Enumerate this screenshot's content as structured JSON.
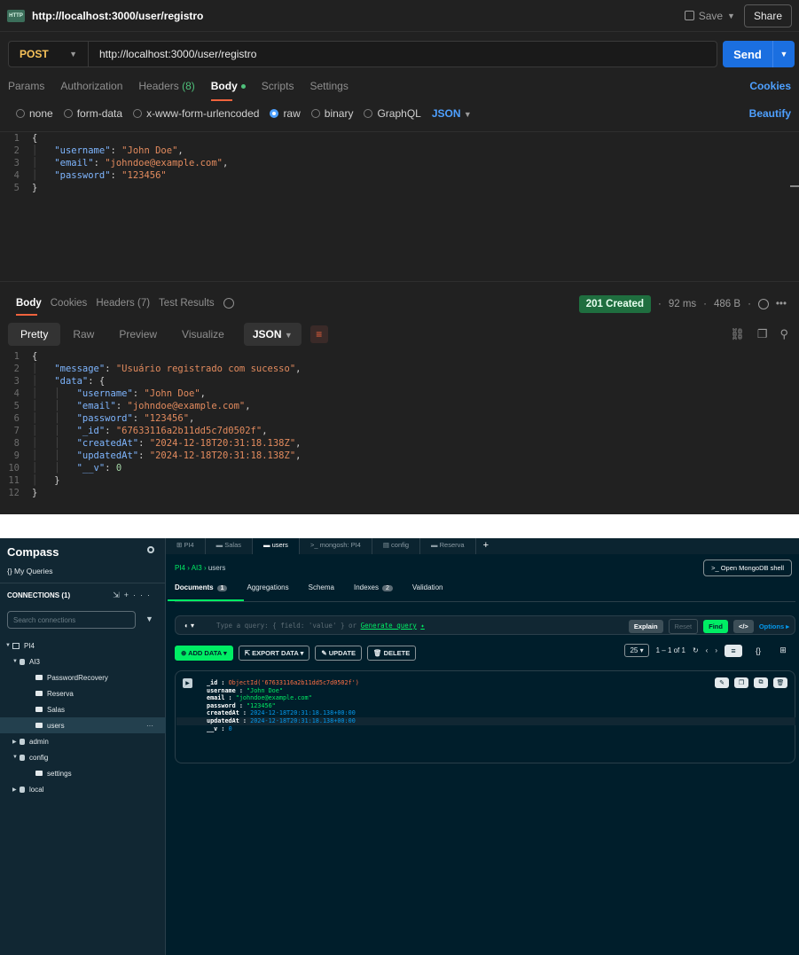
{
  "postman": {
    "window_title": "http://localhost:3000/user/registro",
    "http_icon_text": "HTTP",
    "save_label": "Save",
    "share_label": "Share",
    "method": "POST",
    "url": "http://localhost:3000/user/registro",
    "send_label": "Send",
    "request_tabs": [
      "Params",
      "Authorization",
      "Headers",
      "(8)",
      "Body",
      "Scripts",
      "Settings"
    ],
    "cookies_label": "Cookies",
    "body_types": [
      "none",
      "form-data",
      "x-www-form-urlencoded",
      "raw",
      "binary",
      "GraphQL"
    ],
    "body_format": "JSON",
    "beautify_label": "Beautify",
    "request_body": [
      {
        "n": "1",
        "t": "{"
      },
      {
        "n": "2",
        "k": "\"username\"",
        "v": "\"John Doe\"",
        "c": ","
      },
      {
        "n": "3",
        "k": "\"email\"",
        "v": "\"johndoe@example.com\"",
        "c": ","
      },
      {
        "n": "4",
        "k": "\"password\"",
        "v": "\"123456\"",
        "c": ""
      },
      {
        "n": "5",
        "t": "}"
      }
    ],
    "response_tabs": [
      "Body",
      "Cookies",
      "Headers",
      "(7)",
      "Test Results"
    ],
    "status": "201 Created",
    "time": "92 ms",
    "size": "486 B",
    "more_label": "•••",
    "format_tabs": [
      "Pretty",
      "Raw",
      "Preview",
      "Visualize"
    ],
    "response_format": "JSON",
    "response_body": [
      {
        "n": "1",
        "indent": 0,
        "t": "{"
      },
      {
        "n": "2",
        "indent": 1,
        "k": "\"message\"",
        "v": "\"Usuário registrado com sucesso\"",
        "c": ","
      },
      {
        "n": "3",
        "indent": 1,
        "k": "\"data\"",
        "t2": "{"
      },
      {
        "n": "4",
        "indent": 2,
        "k": "\"username\"",
        "v": "\"John Doe\"",
        "c": ","
      },
      {
        "n": "5",
        "indent": 2,
        "k": "\"email\"",
        "v": "\"johndoe@example.com\"",
        "c": ","
      },
      {
        "n": "6",
        "indent": 2,
        "k": "\"password\"",
        "v": "\"123456\"",
        "c": ","
      },
      {
        "n": "7",
        "indent": 2,
        "k": "\"_id\"",
        "v": "\"67633116a2b11dd5c7d0502f\"",
        "c": ","
      },
      {
        "n": "8",
        "indent": 2,
        "k": "\"createdAt\"",
        "v": "\"2024-12-18T20:31:18.138Z\"",
        "c": ","
      },
      {
        "n": "9",
        "indent": 2,
        "k": "\"updatedAt\"",
        "v": "\"2024-12-18T20:31:18.138Z\"",
        "c": ","
      },
      {
        "n": "10",
        "indent": 2,
        "k": "\"__v\"",
        "num": "0",
        "c": ""
      },
      {
        "n": "11",
        "indent": 1,
        "t": "}"
      },
      {
        "n": "12",
        "indent": 0,
        "t": "}"
      }
    ]
  },
  "compass": {
    "brand": "Compass",
    "my_queries": "My Queries",
    "connections_header": "CONNECTIONS (1)",
    "search_placeholder": "Search connections",
    "tree": [
      "PI4",
      "AI3",
      "PasswordRecovery",
      "Reserva",
      "Salas",
      "users",
      "admin",
      "config",
      "settings",
      "local"
    ],
    "more_label": "···",
    "tabs": [
      "PI4",
      "Salas",
      "users",
      "mongosh: PI4",
      "config",
      "Reserva"
    ],
    "breadcrumb": [
      "PI4",
      "AI3",
      "users"
    ],
    "open_shell": "Open MongoDB shell",
    "subtabs": [
      "Documents",
      "1",
      "Aggregations",
      "Schema",
      "Indexes",
      "2",
      "Validation"
    ],
    "query_placeholder": "Type a query: { field: 'value' } or",
    "generate_query": "Generate query",
    "explain": "Explain",
    "reset": "Reset",
    "find": "Find",
    "code_label": "</>",
    "options": "Options ▸",
    "actions": [
      "ADD DATA",
      "EXPORT DATA",
      "UPDATE",
      "DELETE"
    ],
    "page_size": "25",
    "page_range": "1 – 1 of 1",
    "document": [
      {
        "k": "_id",
        "v": "ObjectId('67633116a2b11dd5c7d0502f')",
        "type": "oid"
      },
      {
        "k": "username",
        "v": "\"John Doe\"",
        "type": "str"
      },
      {
        "k": "email",
        "v": "\"johndoe@example.com\"",
        "type": "str"
      },
      {
        "k": "password",
        "v": "\"123456\"",
        "type": "str"
      },
      {
        "k": "createdAt",
        "v": "2024-12-18T20:31:18.138+00:00",
        "type": "date"
      },
      {
        "k": "updatedAt",
        "v": "2024-12-18T20:31:18.138+00:00",
        "type": "date"
      },
      {
        "k": "__v",
        "v": "0",
        "type": "num"
      }
    ]
  }
}
